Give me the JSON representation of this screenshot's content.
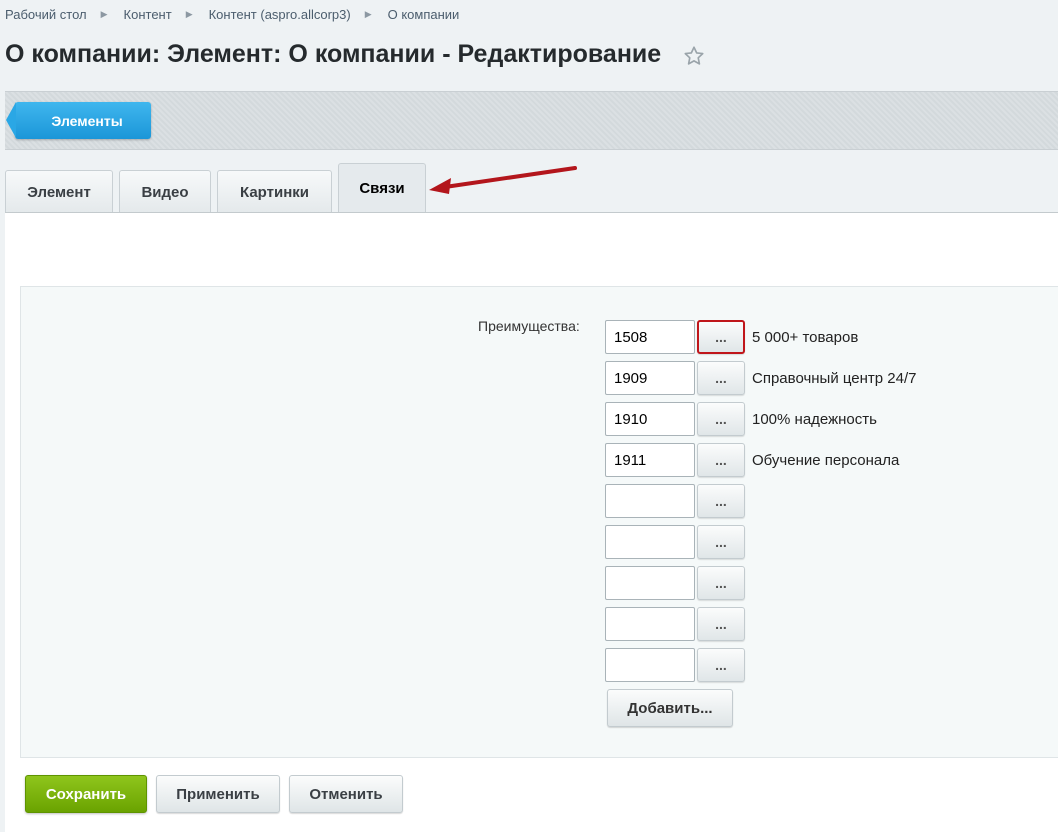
{
  "breadcrumb": [
    {
      "label": "Рабочий стол"
    },
    {
      "label": "Контент"
    },
    {
      "label": "Контент (aspro.allcorp3)"
    },
    {
      "label": "О компании"
    }
  ],
  "page_title": "О компании: Элемент: О компании - Редактирование",
  "toolbar": {
    "elements_label": "Элементы"
  },
  "tabs": [
    {
      "label": "Элемент"
    },
    {
      "label": "Видео"
    },
    {
      "label": "Картинки"
    },
    {
      "label": "Связи"
    }
  ],
  "active_tab": "Связи",
  "form": {
    "field_label": "Преимущества:",
    "browse_label": "...",
    "rows": [
      {
        "id": "1508",
        "name": "5 000+ товаров"
      },
      {
        "id": "1909",
        "name": "Справочный центр 24/7"
      },
      {
        "id": "1910",
        "name": "100% надежность"
      },
      {
        "id": "1911",
        "name": "Обучение персонала"
      },
      {
        "id": "",
        "name": ""
      },
      {
        "id": "",
        "name": ""
      },
      {
        "id": "",
        "name": ""
      },
      {
        "id": "",
        "name": ""
      },
      {
        "id": "",
        "name": ""
      }
    ],
    "add_label": "Добавить..."
  },
  "footer": {
    "save_label": "Сохранить",
    "apply_label": "Применить",
    "cancel_label": "Отменить"
  },
  "colors": {
    "accent_blue": "#1b96d8",
    "save_green": "#6aa300",
    "highlight_red": "#c0161b",
    "annotation_arrow": "#b3161c"
  },
  "icons": {
    "favorite": "star-icon",
    "annotation": "red-arrow-icon",
    "breadcrumb_separator": "chevron-right-icon"
  }
}
